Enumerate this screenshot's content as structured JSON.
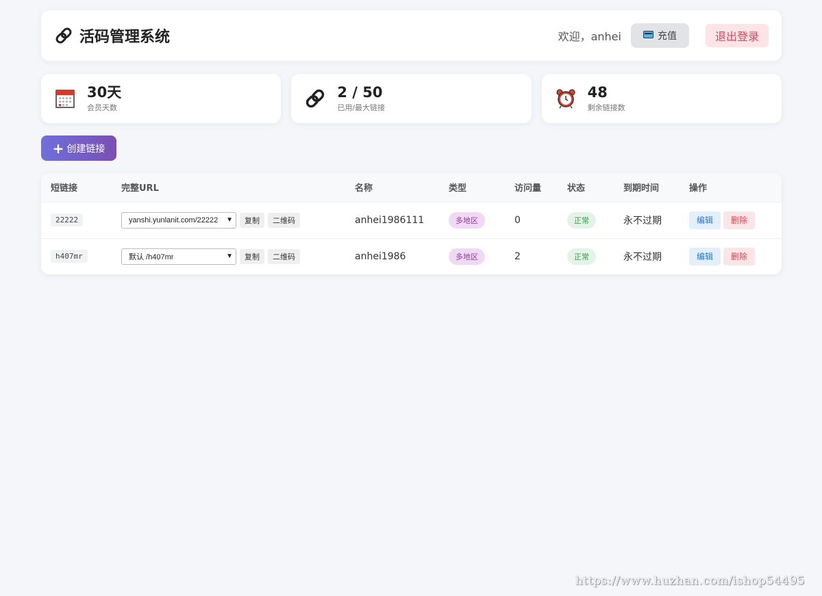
{
  "header": {
    "title": "活码管理系统",
    "welcome": "欢迎，anhei",
    "recharge_label": "充值",
    "logout_label": "退出登录"
  },
  "stats": [
    {
      "icon": "calendar-icon",
      "value": "30天",
      "label": "会员天数"
    },
    {
      "icon": "link-icon",
      "value": "2 / 50",
      "label": "已用/最大链接"
    },
    {
      "icon": "alarm-clock-icon",
      "value": "48",
      "label": "剩余链接数"
    }
  ],
  "create_button": {
    "label": "创建链接"
  },
  "table": {
    "columns": [
      "短链接",
      "完整URL",
      "名称",
      "类型",
      "访问量",
      "状态",
      "到期时间",
      "操作"
    ],
    "copy_label": "复制",
    "qrcode_label": "二维码",
    "edit_label": "编辑",
    "delete_label": "删除",
    "rows": [
      {
        "short": "22222",
        "url": "yanshi.yunlanit.com/22222",
        "name": "anhei1986111",
        "type": "多地区",
        "visits": "0",
        "status": "正常",
        "expire": "永不过期"
      },
      {
        "short": "h407mr",
        "url": "默认 /h407mr",
        "name": "anhei1986",
        "type": "多地区",
        "visits": "2",
        "status": "正常",
        "expire": "永不过期"
      }
    ]
  },
  "watermark": "https://www.huzhan.com/ishop54495"
}
